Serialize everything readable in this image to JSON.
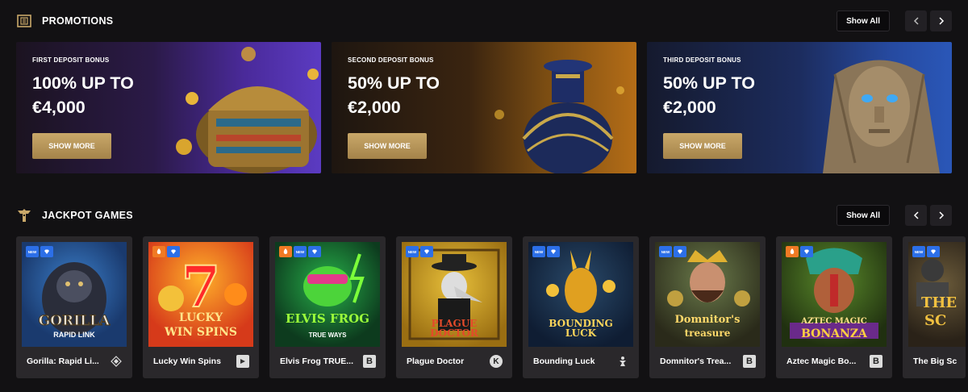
{
  "promotions": {
    "title": "PROMOTIONS",
    "icon": "scroll-icon",
    "show_all": "Show All",
    "items": [
      {
        "label": "FIRST DEPOSIT BONUS",
        "amount_line1": "100% UP TO",
        "amount_line2": "€4,000",
        "button": "SHOW MORE",
        "art": "treasure-chest-image"
      },
      {
        "label": "SECOND DEPOSIT BONUS",
        "amount_line1": "50% UP TO",
        "amount_line2": "€2,000",
        "button": "SHOW MORE",
        "art": "egyptian-vase-image"
      },
      {
        "label": "THIRD DEPOSIT BONUS",
        "amount_line1": "50% UP TO",
        "amount_line2": "€2,000",
        "button": "SHOW MORE",
        "art": "pharaoh-statue-image"
      }
    ]
  },
  "jackpot": {
    "title": "JACKPOT GAMES",
    "icon": "totem-icon",
    "show_all": "Show All",
    "games": [
      {
        "name": "Gorilla: Rapid Li...",
        "thumb_title": "GORILLA",
        "thumb_sub": "RAPID LINK",
        "provider": "diamond-provider-icon",
        "badges": [
          "NEW",
          "drop"
        ]
      },
      {
        "name": "Lucky Win Spins",
        "thumb_title": "LUCKY",
        "thumb_sub": "WIN SPINS",
        "provider": "spinner-provider-icon",
        "badges": [
          "hot",
          "drop"
        ]
      },
      {
        "name": "Elvis Frog TRUE...",
        "thumb_title": "ELVIS FROG",
        "thumb_sub": "TRUE WAYS",
        "provider": "b-provider-icon",
        "badges": [
          "hot",
          "NEW",
          "drop"
        ]
      },
      {
        "name": "Plague Doctor",
        "thumb_title": "PLAGUE",
        "thumb_sub": "DOCTOR",
        "provider": "k-provider-icon",
        "badges": [
          "NEW",
          "drop"
        ]
      },
      {
        "name": "Bounding Luck",
        "thumb_title": "BOUNDING",
        "thumb_sub": "LUCK",
        "provider": "figure-provider-icon",
        "badges": [
          "NEW",
          "drop"
        ]
      },
      {
        "name": "Domnitor's Trea...",
        "thumb_title": "Domnitor's",
        "thumb_sub": "treasure",
        "provider": "b-provider-icon",
        "badges": [
          "NEW",
          "drop"
        ]
      },
      {
        "name": "Aztec Magic Bo...",
        "thumb_title": "AZTEC MAGIC",
        "thumb_sub": "BONANZA",
        "provider": "b-provider-icon",
        "badges": [
          "hot",
          "drop"
        ]
      },
      {
        "name": "The Big Sc",
        "thumb_title": "THE",
        "thumb_sub": "SC",
        "provider": "",
        "badges": [
          "NEW",
          "drop"
        ]
      }
    ]
  },
  "colors": {
    "accent_gold": "#c9a869",
    "background": "#121113",
    "card": "#2a282b",
    "badge_blue": "#2c6fe8",
    "badge_orange": "#f07a24"
  }
}
